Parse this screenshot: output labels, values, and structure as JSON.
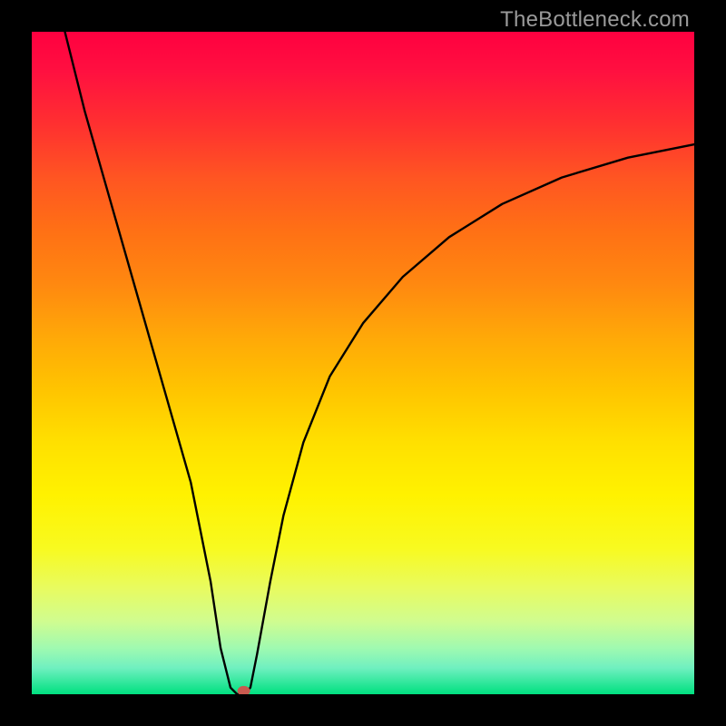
{
  "watermark": "TheBottleneck.com",
  "chart_data": {
    "type": "line",
    "title": "",
    "xlabel": "",
    "ylabel": "",
    "xlim": [
      0,
      100
    ],
    "ylim": [
      0,
      100
    ],
    "grid": false,
    "series": [
      {
        "name": "curve",
        "x": [
          5,
          8,
          12,
          16,
          20,
          24,
          27,
          28.5,
          30,
          31,
          32,
          33,
          34,
          36,
          38,
          41,
          45,
          50,
          56,
          63,
          71,
          80,
          90,
          100
        ],
        "y": [
          100,
          88,
          74,
          60,
          46,
          32,
          17,
          7,
          1,
          0,
          0,
          1,
          6,
          17,
          27,
          38,
          48,
          56,
          63,
          69,
          74,
          78,
          81,
          83
        ]
      }
    ],
    "annotations": [
      {
        "type": "marker",
        "shape": "oval",
        "x": 32,
        "y": 0.5,
        "color": "#c95a4f"
      }
    ],
    "background_gradient": {
      "top_color": "#ff0040",
      "bottom_color": "#00e080"
    }
  }
}
